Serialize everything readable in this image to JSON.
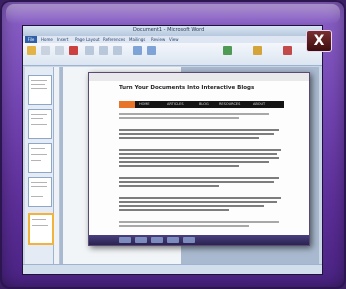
{
  "close_button": {
    "label": "X"
  },
  "word": {
    "title": "Document1 - Microsoft Word",
    "tabs": [
      "File",
      "Home",
      "Insert",
      "Page Layout",
      "References",
      "Mailings",
      "Review",
      "View"
    ]
  },
  "inner_document": {
    "heading": "Turn Your Documents Into Interactive Blogs",
    "nav_items": [
      "HOME",
      "ARTICLES",
      "BLOG",
      "RESOURCES",
      "ABOUT"
    ]
  },
  "colors": {
    "frame": "#7446b3",
    "close": "#5a1a1a",
    "ribbon": "#dbe5f1",
    "accent_orange": "#e8742a"
  }
}
